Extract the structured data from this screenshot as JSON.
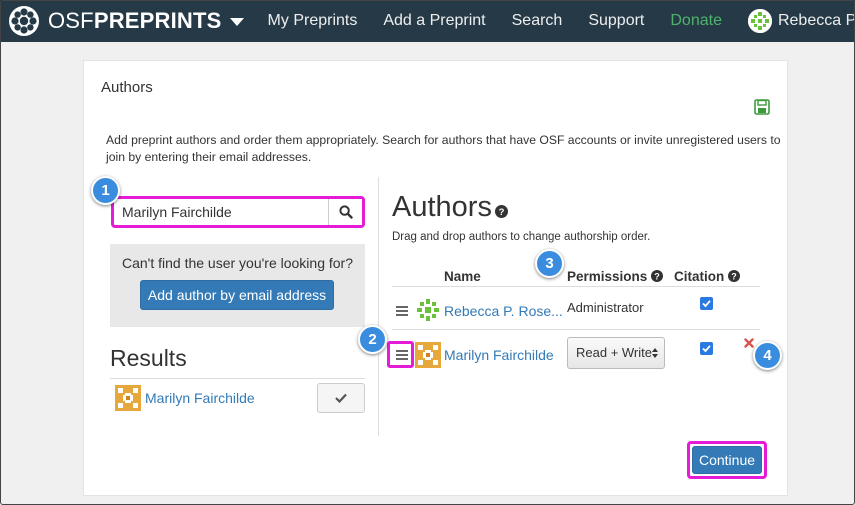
{
  "navbar": {
    "brand_thin": "OSF",
    "brand_bold": "PREPRINTS",
    "links": [
      "My Preprints",
      "Add a Preprint",
      "Search",
      "Support",
      "Donate"
    ],
    "user_name": "Rebecca P. ..."
  },
  "panel": {
    "title": "Authors",
    "intro": "Add preprint authors and order them appropriately. Search for authors that have OSF accounts or invite unregistered users to join by entering their email addresses."
  },
  "search": {
    "value": "Marilyn Fairchilde"
  },
  "help": {
    "text": "Can't find the user you're looking for?",
    "add_email_label": "Add author by email address"
  },
  "results": {
    "title": "Results",
    "items": [
      {
        "name": "Marilyn Fairchilde"
      }
    ]
  },
  "authors": {
    "title": "Authors",
    "hint": "Drag and drop authors to change authorship order.",
    "columns": {
      "name": "Name",
      "permissions": "Permissions",
      "citation": "Citation"
    },
    "rows": [
      {
        "name": "Rebecca P. Rose...",
        "permission": "Administrator",
        "citation": true
      },
      {
        "name": "Marilyn Fairchilde",
        "permission": "Read + Write",
        "citation": true
      }
    ]
  },
  "continue_label": "Continue",
  "callouts": [
    "1",
    "2",
    "3",
    "4"
  ],
  "colors": {
    "navbar": "#263947",
    "accent_blue": "#337ab7",
    "donate_green": "#4fb36b",
    "highlight_magenta": "#e51bd7",
    "callout_blue": "#3a8dde",
    "remove_red": "#d9534f"
  }
}
